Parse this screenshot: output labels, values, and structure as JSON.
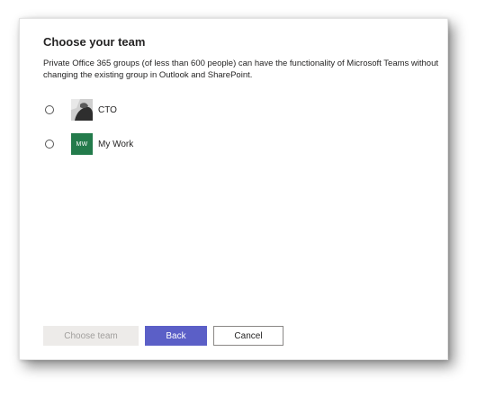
{
  "dialog": {
    "title": "Choose your team",
    "description": "Private Office 365 groups (of less than 600 people) can have the functionality of Microsoft Teams without changing the existing group in Outlook and SharePoint."
  },
  "teams": [
    {
      "name": "CTO",
      "avatar_type": "photo",
      "initials": "",
      "selected": false
    },
    {
      "name": "My Work",
      "avatar_type": "initials",
      "initials": "MW",
      "avatar_color": "#237b4b",
      "selected": false
    }
  ],
  "buttons": {
    "choose_team": "Choose team",
    "back": "Back",
    "cancel": "Cancel"
  },
  "colors": {
    "primary": "#5b5fc7",
    "disabled_bg": "#edebe9",
    "disabled_text": "#a19f9d"
  }
}
